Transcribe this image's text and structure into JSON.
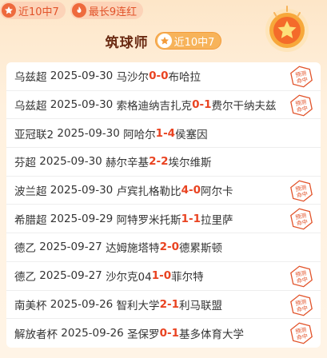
{
  "badges": [
    {
      "icon": "star-icon",
      "label": "近10中7"
    },
    {
      "icon": "fire-icon",
      "label": "最长9连红"
    }
  ],
  "header": {
    "title": "筑球师",
    "pill_label": "近10中7"
  },
  "stamp_text": "预测命中",
  "matches": [
    {
      "league": "乌兹超",
      "date": "2025-09-30",
      "home": "马沙尔",
      "hs": "0",
      "sep": " - ",
      "as": "0",
      "away": "布哈拉",
      "hit": true
    },
    {
      "league": "乌兹超",
      "date": "2025-09-30",
      "home": "索格迪纳吉扎克",
      "hs": "0",
      "sep": " - ",
      "as": "1",
      "away": "费尔干纳夫兹",
      "hit": true
    },
    {
      "league": "亚冠联2",
      "date": "2025-09-30",
      "home": "阿哈尔",
      "hs": "1",
      "sep": " - ",
      "as": "4",
      "away": "侯塞因",
      "hit": false
    },
    {
      "league": "芬超",
      "date": "2025-09-30",
      "home": "赫尔辛基",
      "hs": "2",
      "sep": " - ",
      "as": "2",
      "away": "埃尔维斯",
      "hit": false
    },
    {
      "league": "波兰超",
      "date": "2025-09-30",
      "home": "卢宾扎格勒比",
      "hs": "4",
      "sep": " - ",
      "as": "0",
      "away": "阿尔卡",
      "hit": true
    },
    {
      "league": "希腊超",
      "date": "2025-09-29",
      "home": "阿特罗米托斯",
      "hs": "1",
      "sep": " - ",
      "as": "1",
      "away": "拉里萨",
      "hit": true
    },
    {
      "league": "德乙",
      "date": "2025-09-27",
      "home": "达姆施塔特",
      "hs": "2",
      "sep": " - ",
      "as": "0",
      "away": "德累斯顿",
      "hit": false
    },
    {
      "league": "德乙",
      "date": "2025-09-27",
      "home": "沙尔克04",
      "hs": "1",
      "sep": " - ",
      "as": "0",
      "away": "菲尔特",
      "hit": true
    },
    {
      "league": "南美杯",
      "date": "2025-09-26",
      "home": "智利大学",
      "hs": "2",
      "sep": " - ",
      "as": "1",
      "away": "利马联盟",
      "hit": true
    },
    {
      "league": "解放者杯",
      "date": "2025-09-26",
      "home": "圣保罗",
      "hs": "0",
      "sep": " - ",
      "as": "1",
      "away": "基多体育大学",
      "hit": true
    }
  ],
  "colors": {
    "accent": "#e94321",
    "stamp": "#e2532a",
    "pill": "#f7b35a"
  }
}
